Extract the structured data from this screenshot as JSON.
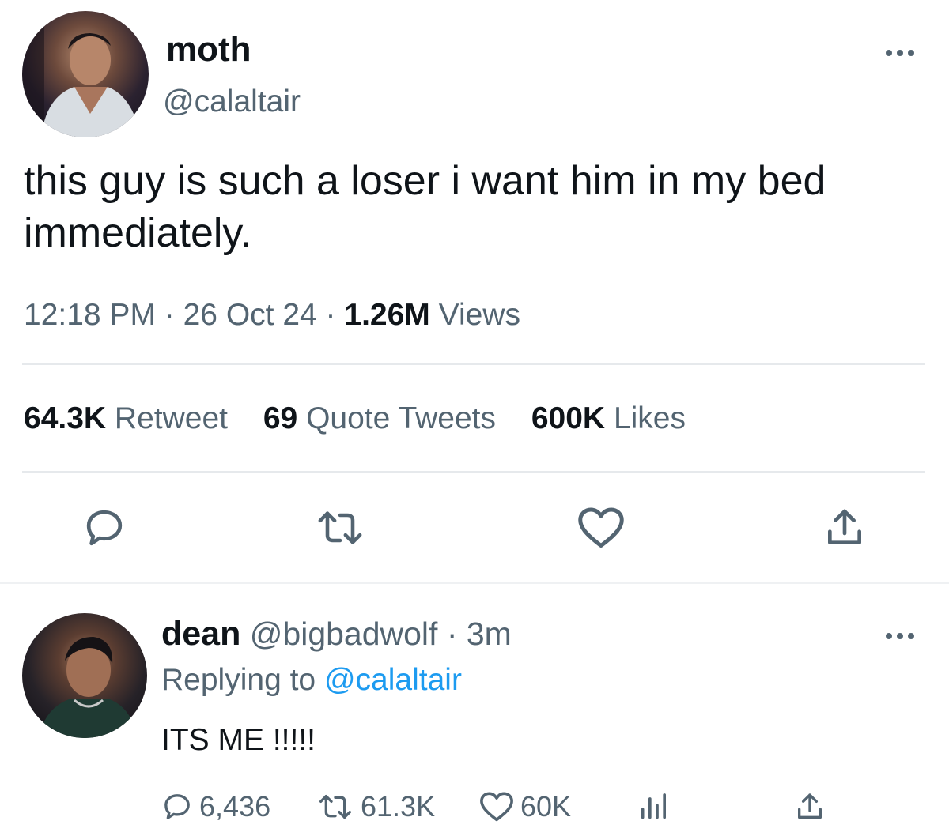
{
  "tweet": {
    "author": {
      "name": "moth",
      "handle": "@calaltair"
    },
    "text": "this guy is such a loser i want him in my bed immediately.",
    "meta": {
      "time": "12:18 PM",
      "separator1": " · ",
      "date": "26 Oct 24",
      "separator2": " · ",
      "views_count": "1.26M",
      "views_label": "Views"
    },
    "stats": {
      "retweets_count": "64.3K",
      "retweets_label": "Retweet",
      "quotes_count": "69",
      "quotes_label": "Quote Tweets",
      "likes_count": "600K",
      "likes_label": "Likes"
    },
    "actions": [
      "comment-icon",
      "retweet-icon",
      "heart-icon",
      "share-icon"
    ]
  },
  "reply": {
    "author": {
      "name": "dean",
      "handle": "@bigbadwolf",
      "separator": " · ",
      "time": "3m"
    },
    "replying_prefix": "Replying to ",
    "replying_to": "@calaltair",
    "text": "ITS ME !!!!!",
    "actions": {
      "comments": "6,436",
      "retweets": "61.3K",
      "likes": "60K"
    }
  },
  "colors": {
    "text": "#0f1419",
    "secondary": "#536471",
    "link": "#1d9bf0",
    "divider": "#e6e9ec"
  }
}
